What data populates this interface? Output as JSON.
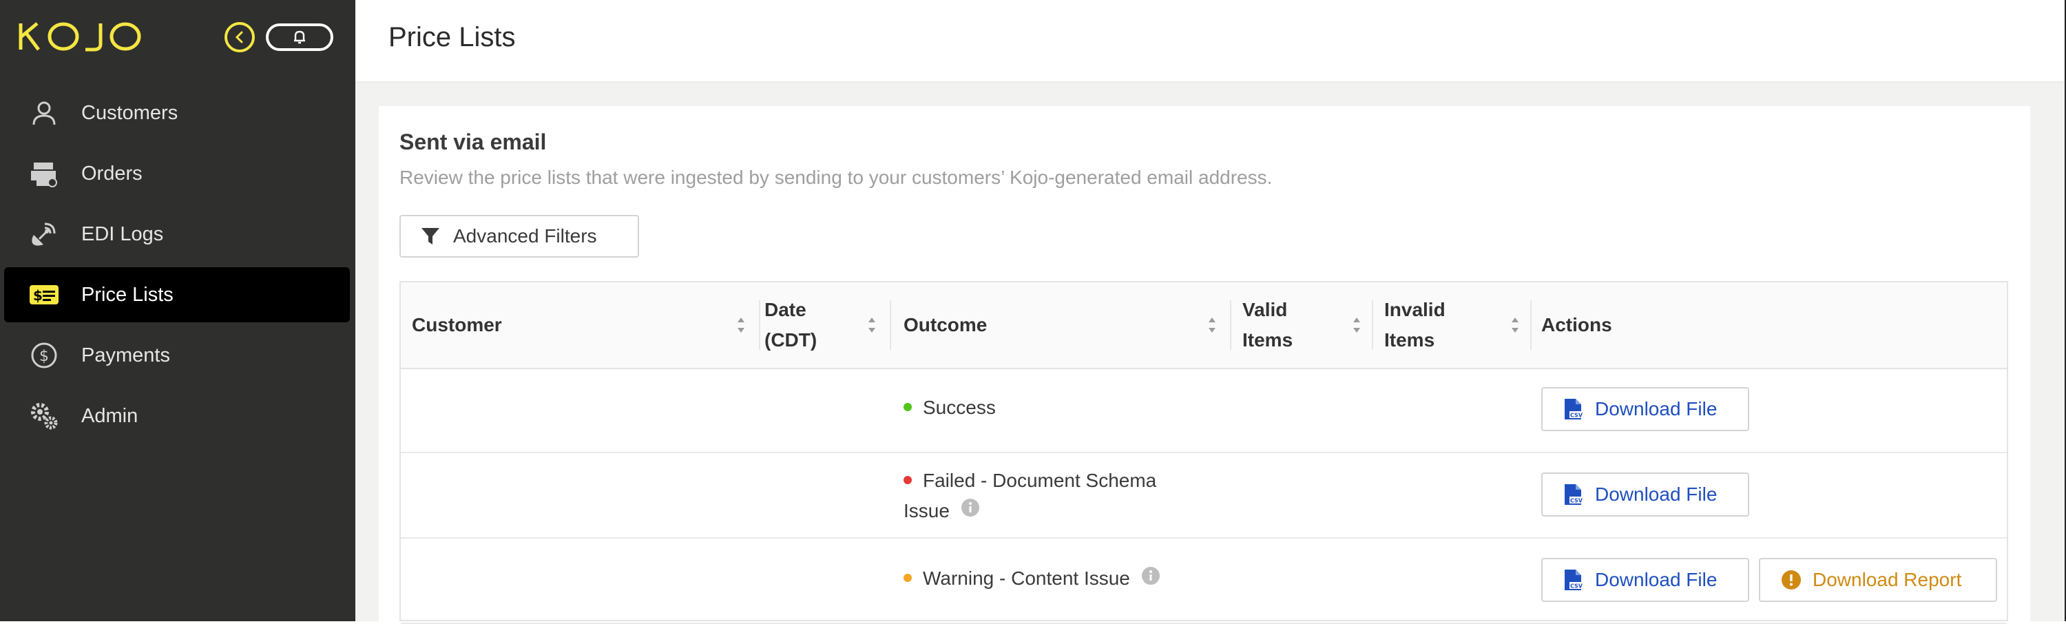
{
  "app": {
    "logo_text": "KOJO",
    "colors": {
      "brand_yellow": "#f5e642",
      "sidebar_bg": "#2f2f2e",
      "link_blue": "#1f4fbf",
      "warning_orange": "#d08a12",
      "success_green": "#52c41a",
      "error_red": "#e53935",
      "warning_dot": "#f5a623"
    }
  },
  "sidebar": {
    "collapse_icon": "chevron-left-icon",
    "notification_icon": "bell-icon",
    "items": [
      {
        "label": "Customers",
        "icon": "user-icon"
      },
      {
        "label": "Orders",
        "icon": "orders-icon"
      },
      {
        "label": "EDI Logs",
        "icon": "satellite-icon"
      },
      {
        "label": "Price Lists",
        "icon": "price-list-icon",
        "active": true
      },
      {
        "label": "Payments",
        "icon": "dollar-circle-icon"
      },
      {
        "label": "Admin",
        "icon": "gears-icon"
      }
    ]
  },
  "header": {
    "title": "Price Lists"
  },
  "section": {
    "title": "Sent via email",
    "subtitle": "Review the price lists that were ingested by sending to your customers’ Kojo-generated email address.",
    "filter_button": "Advanced Filters"
  },
  "table": {
    "columns": {
      "customer": "Customer",
      "date_line1": "Date",
      "date_line2": "(CDT)",
      "outcome": "Outcome",
      "valid_line1": "Valid",
      "valid_line2": "Items",
      "invalid_line1": "Invalid",
      "invalid_line2": "Items",
      "actions": "Actions"
    },
    "rows": [
      {
        "customer": "",
        "date": "",
        "outcome": "Success",
        "status": "success",
        "valid": "",
        "invalid": "",
        "download_label": "Download File"
      },
      {
        "customer": "",
        "date": "",
        "outcome_line1": "Failed - Document Schema",
        "outcome_line2": "Issue",
        "status": "error",
        "valid": "",
        "invalid": "",
        "download_label": "Download File"
      },
      {
        "customer": "",
        "date": "",
        "outcome": "Warning - Content Issue",
        "status": "warning",
        "valid": "",
        "invalid": "",
        "download_label": "Download File",
        "report_label": "Download Report"
      }
    ]
  }
}
